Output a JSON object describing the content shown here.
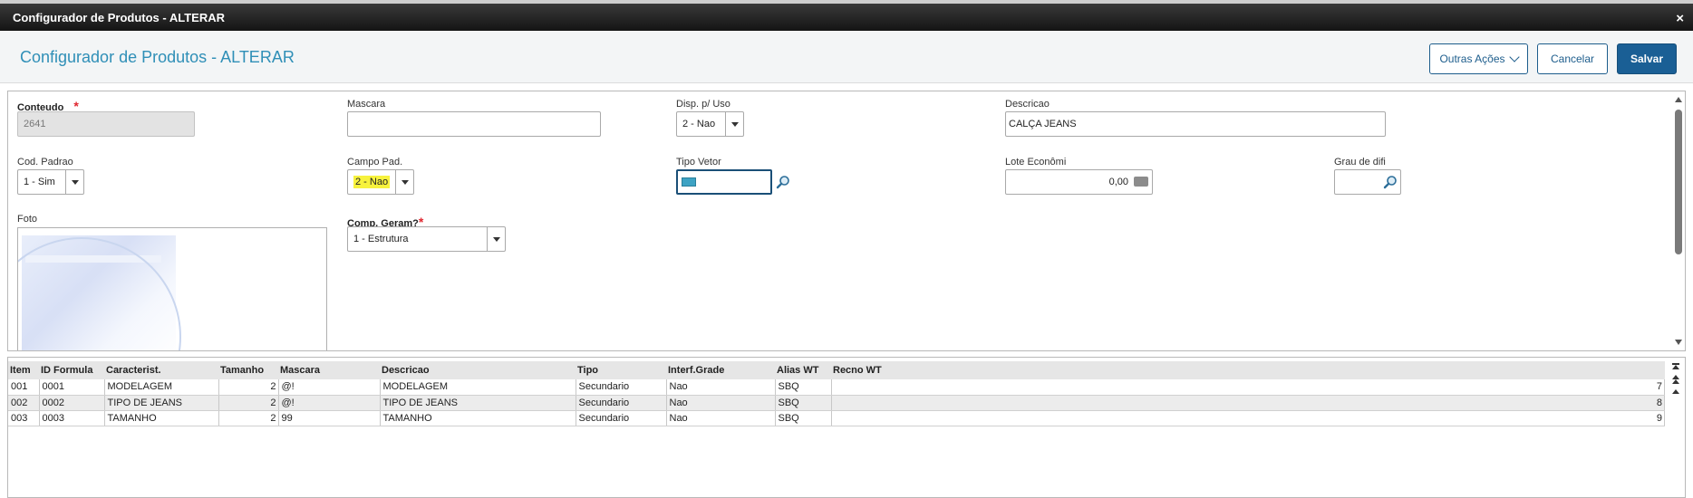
{
  "window": {
    "title": "Configurador de Produtos - ALTERAR",
    "close": "×"
  },
  "header": {
    "title": "Configurador de Produtos - ALTERAR",
    "actions": {
      "outras": "Outras Ações",
      "cancelar": "Cancelar",
      "salvar": "Salvar"
    }
  },
  "form": {
    "conteudo": {
      "label": "Conteudo",
      "required": "*",
      "value": "2641"
    },
    "mascara": {
      "label": "Mascara",
      "value": ""
    },
    "disp_uso": {
      "label": "Disp. p/ Uso",
      "value": "2 - Nao"
    },
    "descricao": {
      "label": "Descricao",
      "value": "CALÇA JEANS"
    },
    "cod_padrao": {
      "label": "Cod. Padrao",
      "value": "1 - Sim"
    },
    "campo_pad": {
      "label": "Campo Pad.",
      "value": "2 - Nao"
    },
    "tipo_vetor": {
      "label": "Tipo Vetor"
    },
    "lote_economico": {
      "label": "Lote Econômi",
      "value": "0,00"
    },
    "grau_dific": {
      "label": "Grau de difi",
      "value": ""
    },
    "foto": {
      "label": "Foto"
    },
    "comp_geram": {
      "label": "Comp. Geram?",
      "required": "*",
      "value": "1 - Estrutura"
    }
  },
  "grid": {
    "columns": [
      "Item",
      "ID Formula",
      "Caracterist.",
      "Tamanho",
      "Mascara",
      "Descricao",
      "Tipo",
      "Interf.Grade",
      "Alias WT",
      "Recno WT"
    ],
    "rows": [
      [
        "001",
        "0001",
        "MODELAGEM",
        "2",
        "@!",
        "MODELAGEM",
        "Secundario",
        "Nao",
        "SBQ",
        "7"
      ],
      [
        "002",
        "0002",
        "TIPO DE JEANS",
        "2",
        "@!",
        "TIPO DE JEANS",
        "Secundario",
        "Nao",
        "SBQ",
        "8"
      ],
      [
        "003",
        "0003",
        "TAMANHO",
        "2",
        "99",
        "TAMANHO",
        "Secundario",
        "Nao",
        "SBQ",
        "9"
      ]
    ]
  },
  "colors": {
    "accent": "#2f8fb7",
    "primary_button": "#1a5f95",
    "required": "#e0262f",
    "highlight": "#f7f23d"
  },
  "icons": [
    "close-icon",
    "chevron-down-icon",
    "search-icon",
    "money-icon",
    "scroll-up-icon",
    "scroll-down-icon",
    "first-page-icon",
    "previous-page-icon"
  ]
}
